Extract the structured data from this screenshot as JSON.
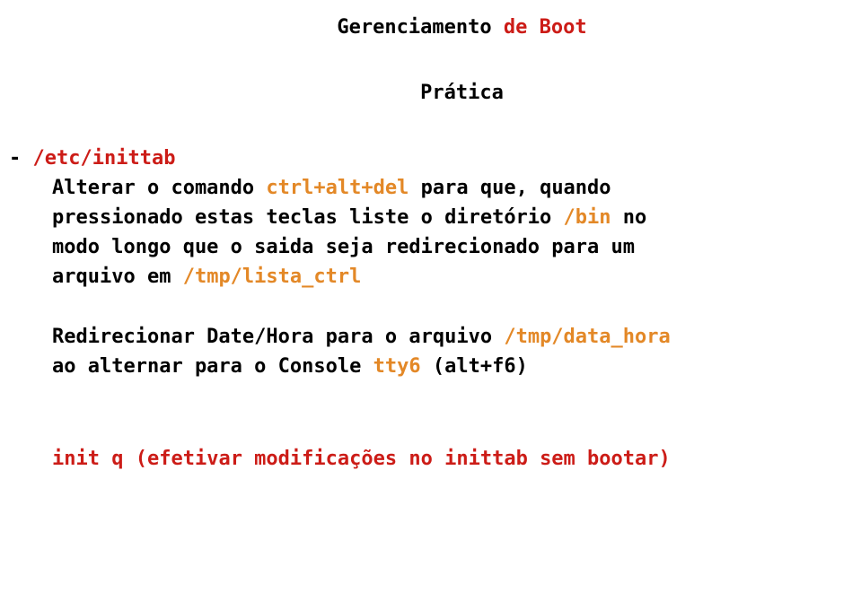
{
  "title": {
    "part1": "Gerenciamento ",
    "part2": "de ",
    "part3": "Boot"
  },
  "subtitle": "Prática",
  "bullet": {
    "dash": "- ",
    "path": "/etc/inittab"
  },
  "para1": {
    "l1a": "Alterar o comando ",
    "l1b": "ctrl+alt+del",
    "l1c": " para que, quando",
    "l2a": "pressionado estas teclas liste o diretório ",
    "l2b": "/bin",
    "l2c": " no",
    "l3": "modo longo que o saida seja redirecionado para um",
    "l4a": "arquivo em ",
    "l4b": "/tmp/lista_ctrl"
  },
  "para2": {
    "l1a": " Redirecionar Date/Hora para o arquivo ",
    "l1b": "/tmp/data_hora",
    "l2a": "ao alternar para o Console ",
    "l2b": "tty6",
    "l2c": " (alt+f6)"
  },
  "footer": {
    "part1": "init q",
    "part2": " (efetivar modificações no inittab sem bootar)"
  }
}
